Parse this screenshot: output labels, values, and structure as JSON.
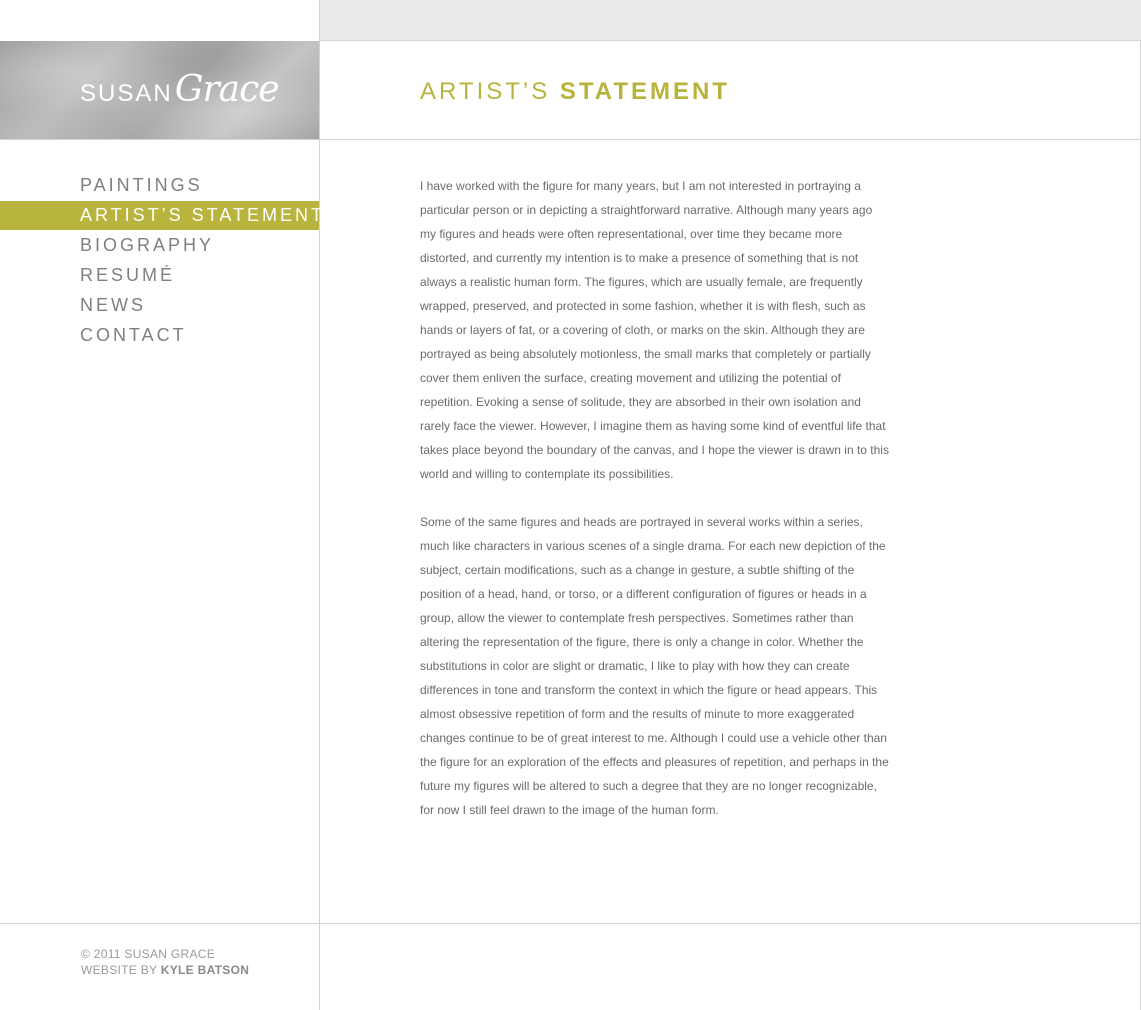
{
  "brand": {
    "first": "SUSAN",
    "last": "Grace"
  },
  "page": {
    "title_light": "ARTIST’S",
    "title_bold": "STATEMENT",
    "accent_color": "#b8b43e"
  },
  "nav": {
    "items": [
      {
        "label": "PAINTINGS",
        "active": false
      },
      {
        "label": "ARTIST’S STATEMENT",
        "active": true
      },
      {
        "label": "BIOGRAPHY",
        "active": false
      },
      {
        "label": "RESUMÉ",
        "active": false
      },
      {
        "label": "NEWS",
        "active": false
      },
      {
        "label": "CONTACT",
        "active": false
      }
    ]
  },
  "statement": {
    "paragraphs": [
      "I have worked with the figure for many years, but I am not interested in portraying a particular person or in depicting a straightforward narrative.  Although many years ago my figures and heads were often representational, over time they became more distorted, and currently my intention is to make a presence of something that is not always a realistic human form.  The figures, which are usually female, are frequently wrapped, preserved, and protected in some fashion, whether it is with flesh, such as hands or layers of fat, or a covering of cloth, or marks on the skin. Although they are portrayed as being absolutely motionless, the small marks that completely or partially cover them enliven the surface, creating movement and utilizing the potential of repetition.  Evoking a sense of solitude, they are absorbed in their own isolation and rarely face the viewer.  However, I imagine them as having some kind of eventful life that takes place beyond the boundary of the canvas, and I hope the viewer is drawn in to this world and willing to contemplate its possibilities.",
      "Some of the same figures and heads are portrayed in several works within a series, much like characters in various scenes of a single drama. For each new depiction of the subject, certain modifications, such as a change in gesture, a subtle shifting of the position of a head, hand, or torso, or a different configuration of figures or heads in a group, allow the viewer to contemplate fresh perspectives. Sometimes rather than altering the representation of the figure, there is only a change in color. Whether the substitutions in color are slight or dramatic, I like to play with how they can create differences in tone and transform the context in which the figure or head appears. This almost obsessive repetition of form and the results of minute to more exaggerated changes continue to be of great interest to me. Although I could use a vehicle other than the figure for an exploration of the effects and pleasures of repetition, and perhaps in the future my figures will be altered to such a degree that they are no longer recognizable, for now I still feel drawn to the image of the human form."
    ]
  },
  "footer": {
    "copyright": "© 2011 SUSAN GRACE",
    "credit_prefix": "WEBSITE BY",
    "credit_name": "KYLE BATSON"
  }
}
